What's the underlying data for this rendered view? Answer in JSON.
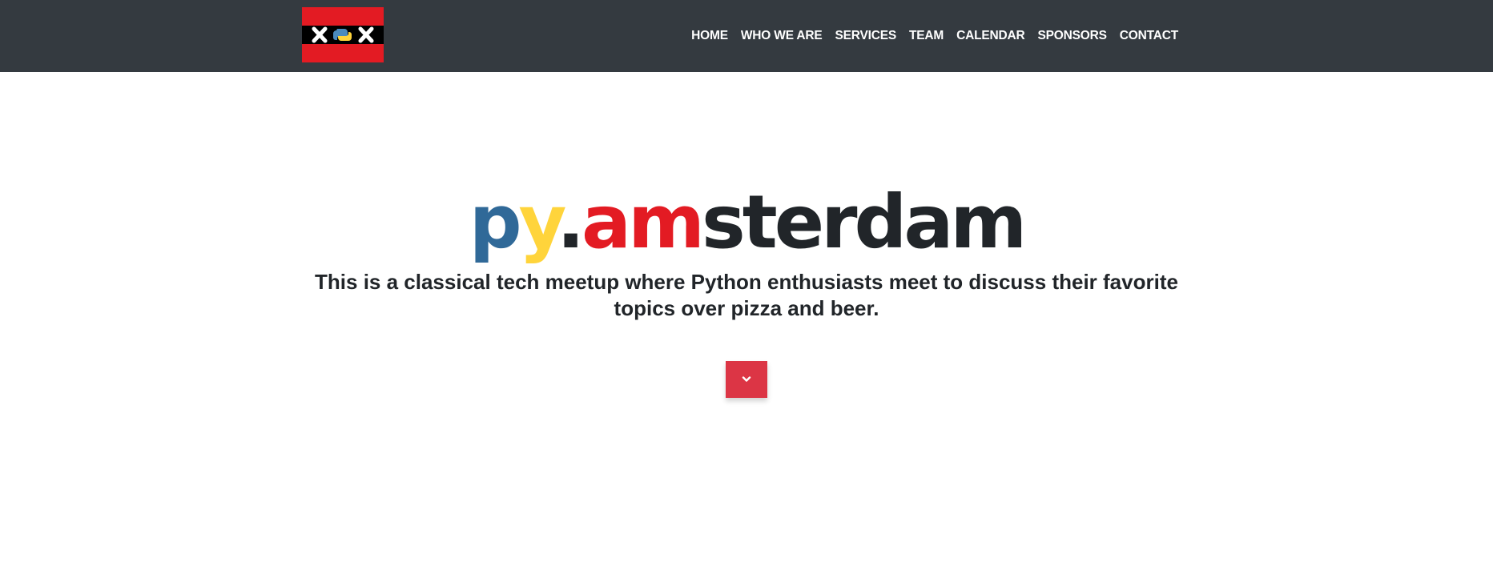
{
  "navbar": {
    "logo": {
      "icon": "amsterdam-python-flag-icon",
      "colors": {
        "red": "#e31b23",
        "black": "#000000",
        "white": "#ffffff"
      }
    },
    "links": [
      {
        "label": "HOME"
      },
      {
        "label": "WHO WE ARE"
      },
      {
        "label": "SERVICES"
      },
      {
        "label": "TEAM"
      },
      {
        "label": "CALENDAR"
      },
      {
        "label": "SPONSORS"
      },
      {
        "label": "CONTACT"
      }
    ],
    "background": "#343a40"
  },
  "hero": {
    "title_parts": {
      "p": "p",
      "y": "y",
      "dot": ".",
      "am": "am",
      "rest": "sterdam"
    },
    "title_colors": {
      "blue": "#306998",
      "yellow": "#ffd43b",
      "red": "#e31b23",
      "dark": "#212529"
    },
    "subtitle": "This is a classical tech meetup where Python enthusiasts meet to discuss their favorite topics over pizza and beer.",
    "scroll_button": {
      "icon": "chevron-down-icon",
      "color": "#dc3545"
    }
  }
}
